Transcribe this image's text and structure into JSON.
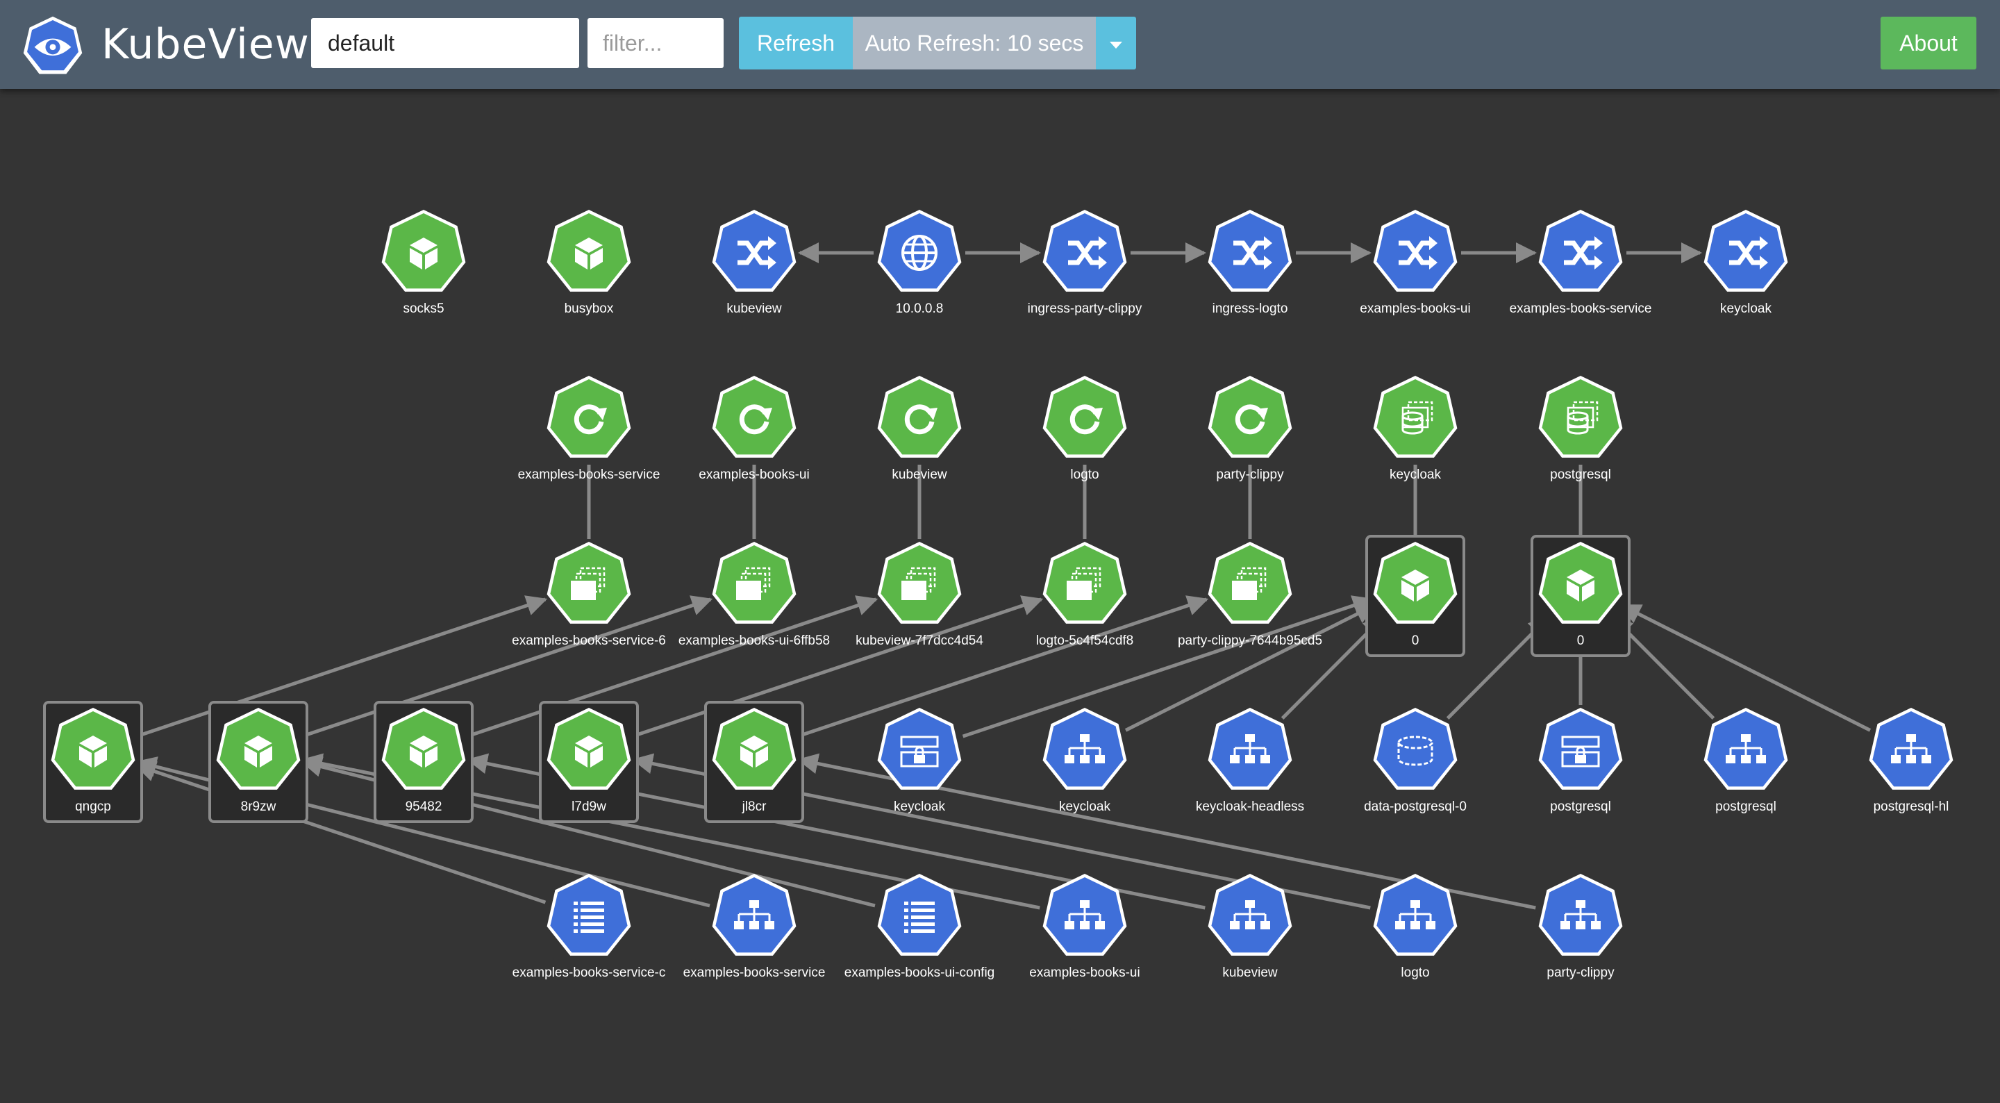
{
  "header": {
    "title": "KubeView",
    "namespace_value": "default",
    "filter_placeholder": "filter...",
    "refresh_label": "Refresh",
    "auto_refresh_label": "Auto Refresh: 10 secs",
    "about_label": "About"
  },
  "colors": {
    "navbar": "#4e5d6c",
    "canvas": "#343434",
    "workload": "#5bb748",
    "network": "#3f6fd9",
    "edge": "#8a8a8a",
    "accent_info": "#5bc0de",
    "accent_success": "#5cb85c"
  },
  "graph": {
    "nodes": [
      {
        "id": "socks5",
        "label": "socks5",
        "kind": "pod"
      },
      {
        "id": "busybox",
        "label": "busybox",
        "kind": "pod"
      },
      {
        "id": "svc-kubeview",
        "label": "kubeview",
        "kind": "service"
      },
      {
        "id": "ip",
        "label": "10.0.0.8",
        "kind": "ip"
      },
      {
        "id": "svc-ingress-party-clippy",
        "label": "ingress-party-clippy",
        "kind": "service"
      },
      {
        "id": "svc-ingress-logto",
        "label": "ingress-logto",
        "kind": "service"
      },
      {
        "id": "svc-examples-books-ui",
        "label": "examples-books-ui",
        "kind": "service"
      },
      {
        "id": "svc-examples-books-service",
        "label": "examples-books-service",
        "kind": "service"
      },
      {
        "id": "svc-keycloak",
        "label": "keycloak",
        "kind": "service"
      },
      {
        "id": "dep-examples-books-service",
        "label": "examples-books-service",
        "kind": "deployment"
      },
      {
        "id": "dep-examples-books-ui",
        "label": "examples-books-ui",
        "kind": "deployment"
      },
      {
        "id": "dep-kubeview",
        "label": "kubeview",
        "kind": "deployment"
      },
      {
        "id": "dep-logto",
        "label": "logto",
        "kind": "deployment"
      },
      {
        "id": "dep-party-clippy",
        "label": "party-clippy",
        "kind": "deployment"
      },
      {
        "id": "sts-keycloak",
        "label": "keycloak",
        "kind": "statefulset"
      },
      {
        "id": "sts-postgresql",
        "label": "postgresql",
        "kind": "statefulset"
      },
      {
        "id": "rs-examples-books-service",
        "label": "examples-books-service-6",
        "kind": "replicaset"
      },
      {
        "id": "rs-examples-books-ui",
        "label": "examples-books-ui-6ffb58",
        "kind": "replicaset"
      },
      {
        "id": "rs-kubeview",
        "label": "kubeview-7f7dcc4d54",
        "kind": "replicaset"
      },
      {
        "id": "rs-logto",
        "label": "logto-5c4f54cdf8",
        "kind": "replicaset"
      },
      {
        "id": "rs-party-clippy",
        "label": "party-clippy-7644b95cd5",
        "kind": "replicaset"
      },
      {
        "id": "pod-keycloak-0",
        "label": "0",
        "kind": "pod",
        "boxed": true
      },
      {
        "id": "pod-postgresql-0",
        "label": "0",
        "kind": "pod",
        "boxed": true
      },
      {
        "id": "pod-qngcp",
        "label": "qngcp",
        "kind": "pod",
        "boxed": true
      },
      {
        "id": "pod-8r9zw",
        "label": "8r9zw",
        "kind": "pod",
        "boxed": true
      },
      {
        "id": "pod-95482",
        "label": "95482",
        "kind": "pod",
        "boxed": true
      },
      {
        "id": "pod-l7d9w",
        "label": "l7d9w",
        "kind": "pod",
        "boxed": true
      },
      {
        "id": "pod-jl8cr",
        "label": "jl8cr",
        "kind": "pod",
        "boxed": true
      },
      {
        "id": "secret-keycloak",
        "label": "keycloak",
        "kind": "secret"
      },
      {
        "id": "svc2-keycloak",
        "label": "keycloak",
        "kind": "endpoint"
      },
      {
        "id": "svc-keycloak-headless",
        "label": "keycloak-headless",
        "kind": "endpoint"
      },
      {
        "id": "pvc-data-postgresql-0",
        "label": "data-postgresql-0",
        "kind": "pvc"
      },
      {
        "id": "secret-postgresql",
        "label": "postgresql",
        "kind": "secret"
      },
      {
        "id": "svc-postgresql",
        "label": "postgresql",
        "kind": "endpoint"
      },
      {
        "id": "svc-postgresql-hl",
        "label": "postgresql-hl",
        "kind": "endpoint"
      },
      {
        "id": "cm-examples-books-service",
        "label": "examples-books-service-c",
        "kind": "configmap"
      },
      {
        "id": "ep-examples-books-service",
        "label": "examples-books-service",
        "kind": "endpoint"
      },
      {
        "id": "cm-examples-books-ui",
        "label": "examples-books-ui-config",
        "kind": "configmap"
      },
      {
        "id": "ep-examples-books-ui",
        "label": "examples-books-ui",
        "kind": "endpoint"
      },
      {
        "id": "ep-kubeview",
        "label": "kubeview",
        "kind": "endpoint"
      },
      {
        "id": "ep-logto",
        "label": "logto",
        "kind": "endpoint"
      },
      {
        "id": "ep-party-clippy",
        "label": "party-clippy",
        "kind": "endpoint"
      }
    ],
    "edges": [
      {
        "from": "ip",
        "to": "svc-kubeview",
        "arrow": true
      },
      {
        "from": "ip",
        "to": "svc-ingress-party-clippy",
        "arrow": true
      },
      {
        "from": "svc-ingress-party-clippy",
        "to": "svc-ingress-logto",
        "arrow": true
      },
      {
        "from": "svc-ingress-logto",
        "to": "svc-examples-books-ui",
        "arrow": true
      },
      {
        "from": "svc-examples-books-ui",
        "to": "svc-examples-books-service",
        "arrow": true
      },
      {
        "from": "svc-examples-books-service",
        "to": "svc-keycloak",
        "arrow": true
      },
      {
        "from": "dep-examples-books-service",
        "to": "rs-examples-books-service",
        "arrow": false
      },
      {
        "from": "dep-examples-books-ui",
        "to": "rs-examples-books-ui",
        "arrow": false
      },
      {
        "from": "dep-kubeview",
        "to": "rs-kubeview",
        "arrow": false
      },
      {
        "from": "dep-logto",
        "to": "rs-logto",
        "arrow": false
      },
      {
        "from": "dep-party-clippy",
        "to": "rs-party-clippy",
        "arrow": false
      },
      {
        "from": "sts-keycloak",
        "to": "pod-keycloak-0",
        "arrow": false
      },
      {
        "from": "sts-postgresql",
        "to": "pod-postgresql-0",
        "arrow": false
      },
      {
        "from": "pod-qngcp",
        "to": "rs-examples-books-service",
        "arrow": true
      },
      {
        "from": "pod-8r9zw",
        "to": "rs-examples-books-ui",
        "arrow": true
      },
      {
        "from": "pod-95482",
        "to": "rs-kubeview",
        "arrow": true
      },
      {
        "from": "pod-l7d9w",
        "to": "rs-logto",
        "arrow": true
      },
      {
        "from": "pod-jl8cr",
        "to": "rs-party-clippy",
        "arrow": true
      },
      {
        "from": "secret-keycloak",
        "to": "pod-keycloak-0",
        "arrow": true
      },
      {
        "from": "svc2-keycloak",
        "to": "pod-keycloak-0",
        "arrow": true
      },
      {
        "from": "svc-keycloak-headless",
        "to": "pod-keycloak-0",
        "arrow": true
      },
      {
        "from": "pvc-data-postgresql-0",
        "to": "pod-postgresql-0",
        "arrow": true
      },
      {
        "from": "secret-postgresql",
        "to": "pod-postgresql-0",
        "arrow": true
      },
      {
        "from": "svc-postgresql",
        "to": "pod-postgresql-0",
        "arrow": true
      },
      {
        "from": "svc-postgresql-hl",
        "to": "pod-postgresql-0",
        "arrow": true
      },
      {
        "from": "cm-examples-books-service",
        "to": "pod-qngcp",
        "arrow": true
      },
      {
        "from": "ep-examples-books-service",
        "to": "pod-qngcp",
        "arrow": true
      },
      {
        "from": "cm-examples-books-ui",
        "to": "pod-8r9zw",
        "arrow": true
      },
      {
        "from": "ep-examples-books-ui",
        "to": "pod-8r9zw",
        "arrow": true
      },
      {
        "from": "ep-kubeview",
        "to": "pod-95482",
        "arrow": true
      },
      {
        "from": "ep-logto",
        "to": "pod-l7d9w",
        "arrow": true
      },
      {
        "from": "ep-party-clippy",
        "to": "pod-jl8cr",
        "arrow": true
      }
    ]
  }
}
